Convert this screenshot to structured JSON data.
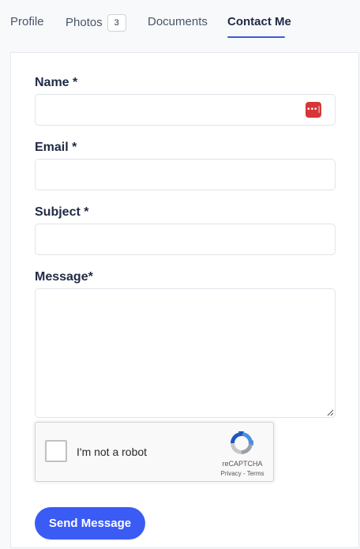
{
  "tabs": [
    {
      "label": "Profile"
    },
    {
      "label": "Photos",
      "badge": "3"
    },
    {
      "label": "Documents"
    },
    {
      "label": "Contact Me",
      "active": true
    }
  ],
  "form": {
    "name": {
      "label": "Name *",
      "value": "",
      "placeholder": ""
    },
    "email": {
      "label": "Email *",
      "value": "",
      "placeholder": ""
    },
    "subject": {
      "label": "Subject *",
      "value": "",
      "placeholder": ""
    },
    "message": {
      "label": "Message*",
      "value": "",
      "placeholder": ""
    },
    "password_manager_icon": {
      "icon": "password-manager-icon",
      "glyph": "•••|",
      "color": "#d63638"
    },
    "submit_label": "Send Message"
  },
  "recaptcha": {
    "checkbox_label": "I'm not a robot",
    "brand": "reCAPTCHA",
    "privacy_label": "Privacy",
    "separator": " - ",
    "terms_label": "Terms",
    "checked": false
  },
  "colors": {
    "accent": "#3b5bf5",
    "tab_underline": "#3b5bdb",
    "text": "#1f2a44"
  }
}
